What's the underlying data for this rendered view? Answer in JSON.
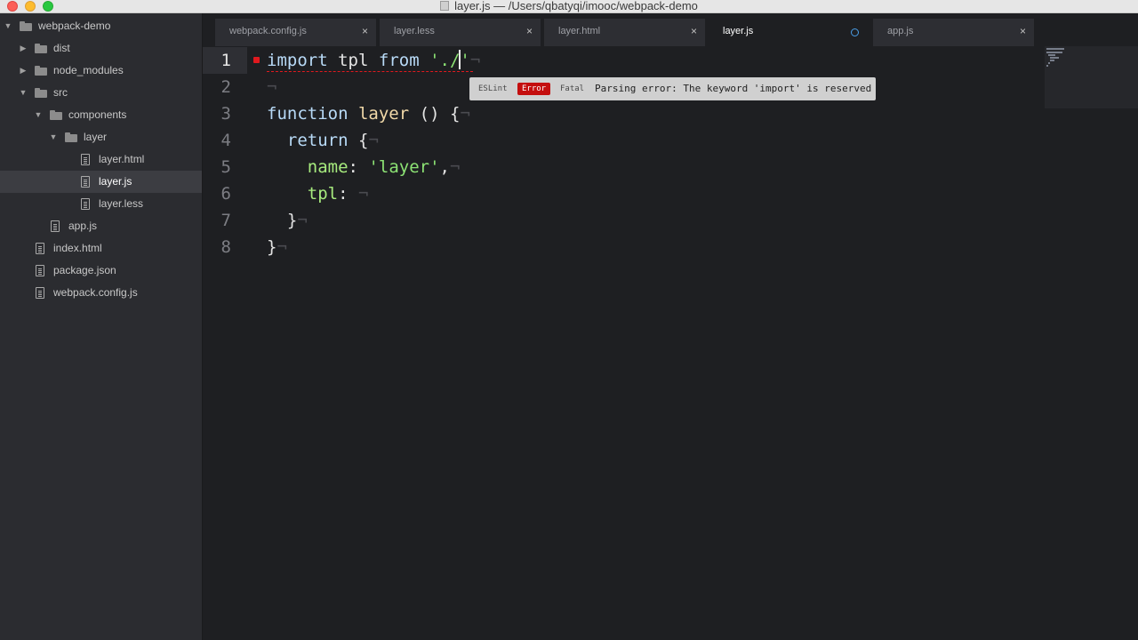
{
  "window": {
    "title": "layer.js — /Users/qbatyqi/imooc/webpack-demo"
  },
  "sidebar": {
    "items": [
      {
        "label": "webpack-demo",
        "type": "folder",
        "expanded": true,
        "depth": 0
      },
      {
        "label": "dist",
        "type": "folder",
        "expanded": false,
        "depth": 1
      },
      {
        "label": "node_modules",
        "type": "folder",
        "expanded": false,
        "depth": 1
      },
      {
        "label": "src",
        "type": "folder",
        "expanded": true,
        "depth": 1
      },
      {
        "label": "components",
        "type": "folder",
        "expanded": true,
        "depth": 2
      },
      {
        "label": "layer",
        "type": "folder",
        "expanded": true,
        "depth": 3
      },
      {
        "label": "layer.html",
        "type": "file",
        "depth": 4
      },
      {
        "label": "layer.js",
        "type": "file",
        "depth": 4,
        "selected": true
      },
      {
        "label": "layer.less",
        "type": "file",
        "depth": 4
      },
      {
        "label": "app.js",
        "type": "file",
        "depth": 2
      },
      {
        "label": "index.html",
        "type": "file",
        "depth": 1
      },
      {
        "label": "package.json",
        "type": "file",
        "depth": 1
      },
      {
        "label": "webpack.config.js",
        "type": "file",
        "depth": 1
      }
    ]
  },
  "tabs": [
    {
      "label": "webpack.config.js",
      "active": false,
      "modified": false
    },
    {
      "label": "layer.less",
      "active": false,
      "modified": false
    },
    {
      "label": "layer.html",
      "active": false,
      "modified": false
    },
    {
      "label": "layer.js",
      "active": true,
      "modified": true
    },
    {
      "label": "app.js",
      "active": false,
      "modified": false
    }
  ],
  "tab_close_glyph": "×",
  "editor": {
    "current_line": 1,
    "line_numbers": [
      "1",
      "2",
      "3",
      "4",
      "5",
      "6",
      "7",
      "8"
    ],
    "code": [
      "import tpl from './'",
      "",
      "function layer () {",
      "  return {",
      "    name: 'layer',",
      "    tpl: ",
      "  }",
      "}"
    ]
  },
  "lint": {
    "provider": "ESLint",
    "severity": "Error",
    "level": "Fatal",
    "message": "Parsing error: The keyword 'import' is reserved"
  },
  "colors": {
    "error": "#c40e0e",
    "modified_dot": "#4a9ee8",
    "keyword": "#b8daf7",
    "string": "#8ce274"
  }
}
